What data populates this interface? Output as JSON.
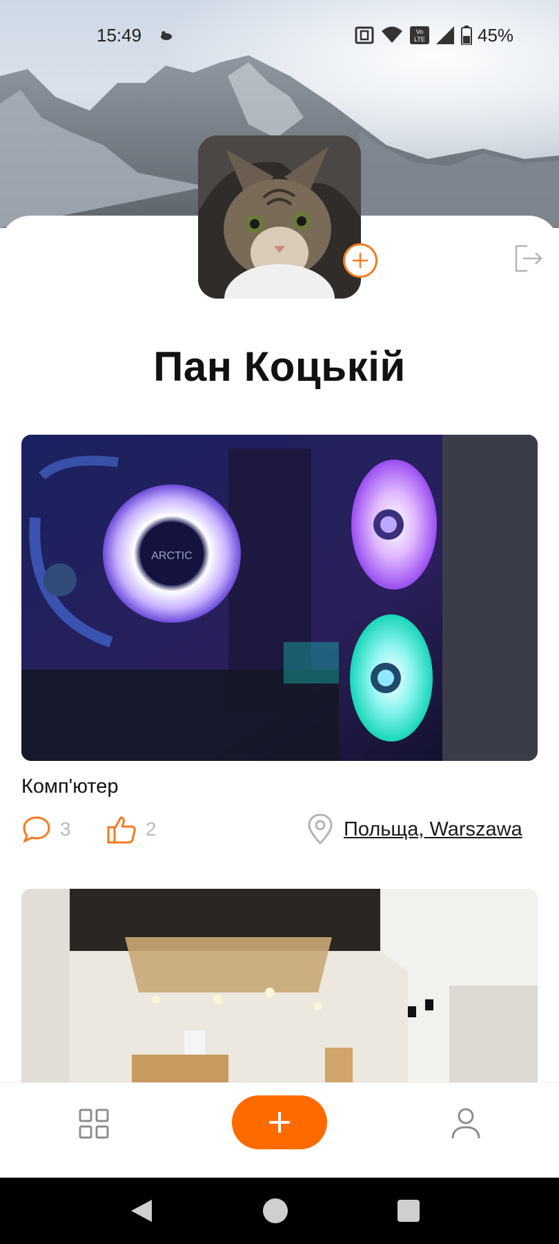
{
  "status_bar": {
    "time": "15:49",
    "battery": "45%",
    "icons": [
      "nfc-icon",
      "wifi-icon",
      "volte-icon",
      "signal-icon",
      "battery-icon"
    ],
    "volte_label": "Vo\nLTE"
  },
  "profile": {
    "name": "Пан Коцькій",
    "avatar": "cat-avatar"
  },
  "posts": [
    {
      "title": "Комп'ютер",
      "comments": "3",
      "likes": "2",
      "location": "Польща, Warszawa",
      "image": "pc-rgb-fans-photo"
    },
    {
      "image": "room-renovation-photo"
    }
  ],
  "bottom_nav": {
    "items": [
      "grid-icon",
      "add-icon",
      "profile-icon"
    ]
  },
  "colors": {
    "accent": "#ff6a00",
    "accent_icon": "#f47a1f",
    "muted": "#b9b9b9"
  }
}
